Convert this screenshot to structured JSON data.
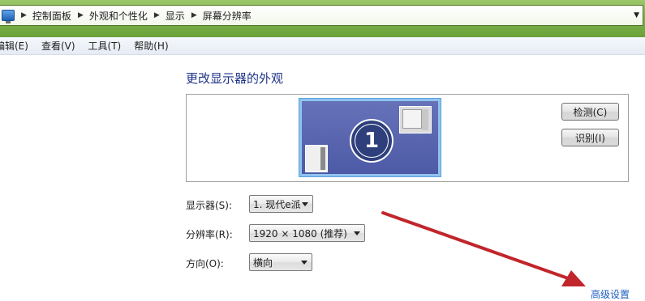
{
  "address_bar": {
    "breadcrumbs": [
      "控制面板",
      "外观和个性化",
      "显示",
      "屏幕分辨率"
    ]
  },
  "menu": {
    "items": [
      "编辑(E)",
      "查看(V)",
      "工具(T)",
      "帮助(H)"
    ]
  },
  "main": {
    "title": "更改显示器的外观",
    "monitor_number": "1",
    "detect_button": "检测(C)",
    "identify_button": "识别(I)",
    "display": {
      "label": "显示器(S):",
      "value": "1. 现代e派"
    },
    "resolution": {
      "label": "分辨率(R):",
      "value": "1920 × 1080 (推荐)"
    },
    "orientation": {
      "label": "方向(O):",
      "value": "横向"
    },
    "advanced_link": "高级设置"
  },
  "colors": {
    "title_blue": "#1e3287",
    "link_blue": "#1e5fc2",
    "annotation_arrow": "#c0262b",
    "glass_green": "#7fb24c"
  }
}
